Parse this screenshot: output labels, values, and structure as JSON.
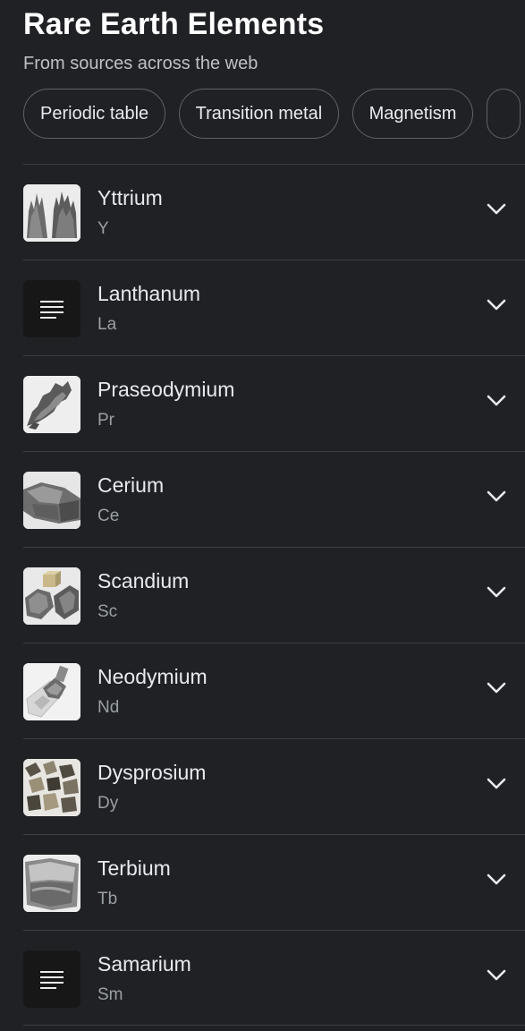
{
  "header": {
    "title": "Rare Earth Elements",
    "subtitle": "From sources across the web"
  },
  "chips": [
    {
      "label": "Periodic table"
    },
    {
      "label": "Transition metal"
    },
    {
      "label": "Magnetism"
    },
    {
      "label": ""
    }
  ],
  "elements": [
    {
      "name": "Yttrium",
      "symbol": "Y",
      "thumb": "image"
    },
    {
      "name": "Lanthanum",
      "symbol": "La",
      "thumb": "document-icon"
    },
    {
      "name": "Praseodymium",
      "symbol": "Pr",
      "thumb": "image"
    },
    {
      "name": "Cerium",
      "symbol": "Ce",
      "thumb": "image"
    },
    {
      "name": "Scandium",
      "symbol": "Sc",
      "thumb": "image"
    },
    {
      "name": "Neodymium",
      "symbol": "Nd",
      "thumb": "image"
    },
    {
      "name": "Dysprosium",
      "symbol": "Dy",
      "thumb": "image"
    },
    {
      "name": "Terbium",
      "symbol": "Tb",
      "thumb": "image"
    },
    {
      "name": "Samarium",
      "symbol": "Sm",
      "thumb": "document-icon"
    }
  ],
  "colors": {
    "background": "#202124",
    "text_primary": "#e8eaed",
    "text_secondary": "#9aa0a6",
    "divider": "#3c4043",
    "chip_border": "#5f6368"
  }
}
